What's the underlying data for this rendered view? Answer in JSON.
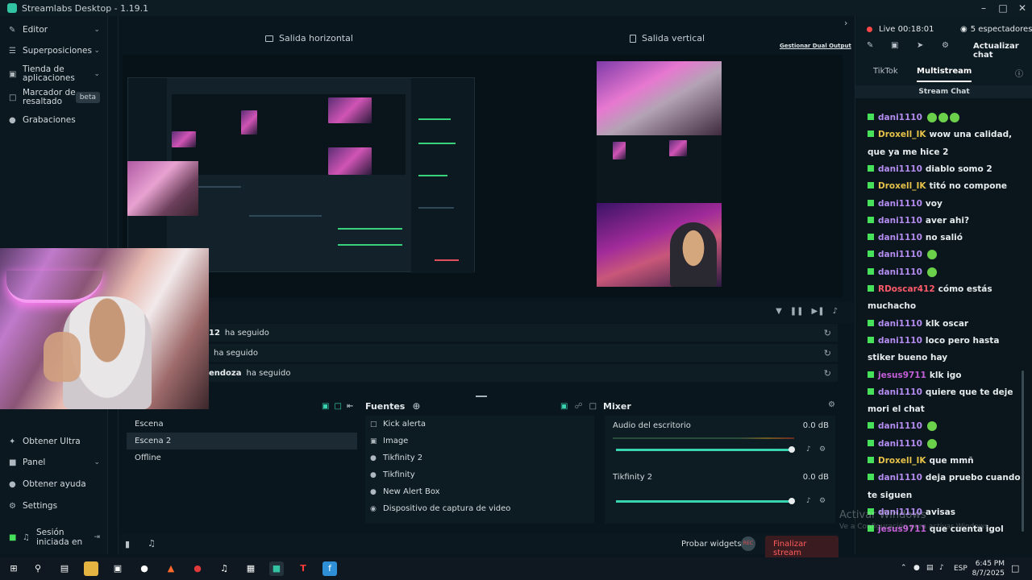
{
  "window": {
    "title": "Streamlabs Desktop - 1.19.1"
  },
  "sidebar": {
    "items": [
      {
        "label": "Editor",
        "icon": "edit-icon",
        "chevron": true
      },
      {
        "label": "Superposiciones",
        "icon": "layers-icon",
        "chevron": true
      },
      {
        "label": "Tienda de aplicaciones",
        "icon": "store-icon",
        "chevron": true
      },
      {
        "label": "Marcador de resaltado",
        "icon": "highlighter-icon",
        "badge": "beta"
      },
      {
        "label": "Grabaciones",
        "icon": "record-icon"
      }
    ],
    "bottom": [
      {
        "label": "Obtener Ultra",
        "icon": "ultra-icon"
      },
      {
        "label": "Panel",
        "icon": "dashboard-icon",
        "chevron": true
      },
      {
        "label": "Obtener ayuda",
        "icon": "help-icon"
      },
      {
        "label": "Settings",
        "icon": "gear-icon"
      },
      {
        "label": "Sesión iniciada en",
        "icon": "kick-icon"
      }
    ]
  },
  "preview": {
    "horizontal_label": "Salida horizontal",
    "vertical_label": "Salida vertical",
    "dual_output_link": "Gestionar Dual Output"
  },
  "events": {
    "rows": [
      {
        "who": "12",
        "action": "ha seguido"
      },
      {
        "who": "",
        "action": "ha seguido"
      },
      {
        "who": "endoza",
        "action": "ha seguido"
      }
    ]
  },
  "scenes": {
    "items": [
      "Escena",
      "Escena 2",
      "Offline"
    ],
    "selected": "Escena 2"
  },
  "sources": {
    "title": "Fuentes",
    "items": [
      {
        "label": "Kick alerta",
        "icon": "folder-icon"
      },
      {
        "label": "Image",
        "icon": "image-icon"
      },
      {
        "label": "Tikfinity 2",
        "icon": "globe-icon"
      },
      {
        "label": "Tikfinity",
        "icon": "globe-icon"
      },
      {
        "label": "New Alert Box",
        "icon": "globe-icon"
      },
      {
        "label": "Dispositivo de captura de video",
        "icon": "camera-icon"
      }
    ]
  },
  "mixer": {
    "title": "Mixer",
    "channels": [
      {
        "name": "Audio del escritorio",
        "db": "0.0 dB",
        "level": 1.0
      },
      {
        "name": "Tikfinity 2",
        "db": "0.0 dB",
        "level": 1.0
      }
    ]
  },
  "statusbar": {
    "test_widgets": "Probar widgets",
    "rec_label": "REC",
    "end_stream": "Finalizar stream"
  },
  "chat": {
    "live_time": "Live 00:18:01",
    "viewers": "5 espectadores",
    "refresh": "Actualizar chat",
    "tabs": [
      "TikTok",
      "Multistream"
    ],
    "active_tab": "Multistream",
    "section_label": "Stream Chat",
    "messages": [
      {
        "user": "dani1110",
        "color": "#b48cf0",
        "text": "",
        "emotes": 3
      },
      {
        "user": "Droxell_IK",
        "color": "#e6c14a",
        "text": "wow una calidad, que ya me hice 2"
      },
      {
        "user": "dani1110",
        "color": "#b48cf0",
        "text": "diablo somo 2"
      },
      {
        "user": "Droxell_IK",
        "color": "#e6c14a",
        "text": "titó no compone"
      },
      {
        "user": "dani1110",
        "color": "#b48cf0",
        "text": "voy"
      },
      {
        "user": "dani1110",
        "color": "#b48cf0",
        "text": "aver ahi?"
      },
      {
        "user": "dani1110",
        "color": "#b48cf0",
        "text": "no salió"
      },
      {
        "user": "dani1110",
        "color": "#b48cf0",
        "text": "",
        "emotes": 1
      },
      {
        "user": "dani1110",
        "color": "#b48cf0",
        "text": "",
        "emotes": 1
      },
      {
        "user": "RDoscar412",
        "color": "#ff5a6a",
        "text": "cómo estás muchacho"
      },
      {
        "user": "dani1110",
        "color": "#b48cf0",
        "text": "klk oscar"
      },
      {
        "user": "dani1110",
        "color": "#b48cf0",
        "text": "loco pero hasta stiker bueno hay"
      },
      {
        "user": "jesus9711",
        "color": "#c45fd8",
        "text": "klk igo"
      },
      {
        "user": "dani1110",
        "color": "#b48cf0",
        "text": "quiere que te deje mori el chat"
      },
      {
        "user": "dani1110",
        "color": "#b48cf0",
        "text": "",
        "emotes": 1
      },
      {
        "user": "dani1110",
        "color": "#b48cf0",
        "text": "",
        "emotes": 1
      },
      {
        "user": "Droxell_IK",
        "color": "#e6c14a",
        "text": "que mmñ"
      },
      {
        "user": "dani1110",
        "color": "#b48cf0",
        "text": "deja pruebo cuando te siguen"
      },
      {
        "user": "dani1110",
        "color": "#b48cf0",
        "text": "avisas"
      },
      {
        "user": "jesus9711",
        "color": "#c45fd8",
        "text": "que cuenta igol"
      }
    ]
  },
  "windows_watermark": {
    "line1": "Activar Windows",
    "line2": "Ve a Configuración para activar Windows."
  },
  "taskbar": {
    "language": "ESP",
    "time": "6:45 PM",
    "date": "8/7/2025"
  }
}
